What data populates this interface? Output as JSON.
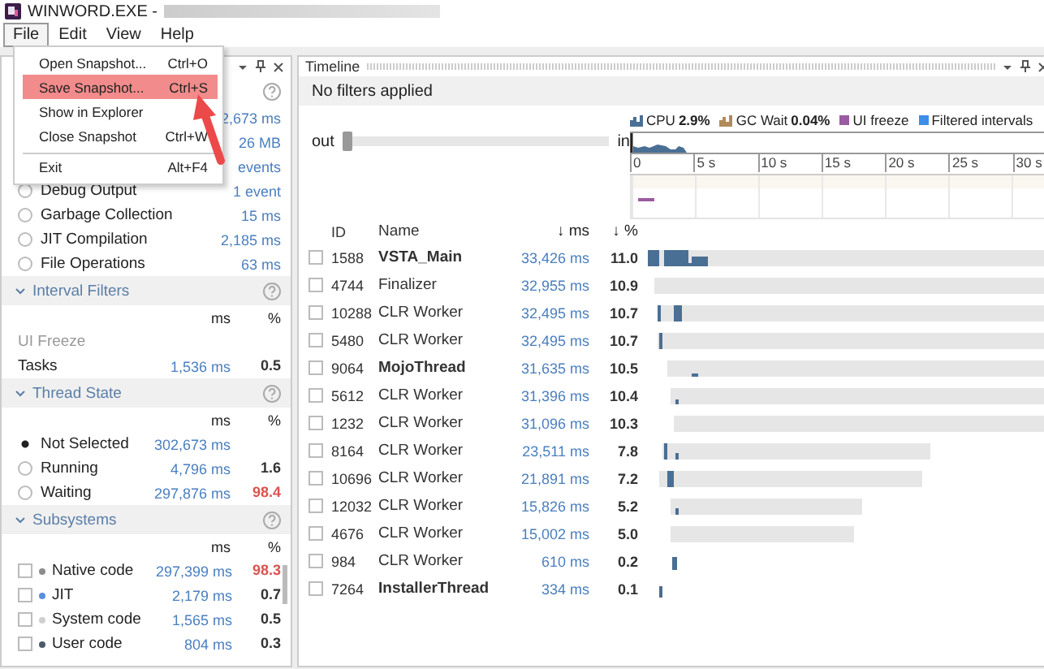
{
  "window": {
    "title": "WINWORD.EXE -"
  },
  "menu_bar": [
    {
      "label": "File",
      "selected": true
    },
    {
      "label": "Edit",
      "selected": false
    },
    {
      "label": "View",
      "selected": false
    },
    {
      "label": "Help",
      "selected": false
    }
  ],
  "file_menu": [
    {
      "label": "Open Snapshot...",
      "shortcut": "Ctrl+O",
      "selected": false,
      "separator_before": false
    },
    {
      "label": "Save Snapshot...",
      "shortcut": "Ctrl+S",
      "selected": true,
      "separator_before": false
    },
    {
      "label": "Show in Explorer",
      "selected": false,
      "separator_before": false
    },
    {
      "label": "Close Snapshot",
      "shortcut": "Ctrl+W",
      "selected": false,
      "separator_before": false
    },
    {
      "label": "Exit",
      "shortcut": "Alt+F4",
      "selected": false,
      "separator_before": true
    }
  ],
  "filters_panel": {
    "events": [
      {
        "value": "2,673 ms"
      },
      {
        "value": "26 MB"
      },
      {
        "value": "events"
      },
      {
        "label": "Debug Output",
        "value": "1 event",
        "selected": false
      },
      {
        "label": "Garbage Collection",
        "value": "15 ms",
        "selected": false
      },
      {
        "label": "JIT Compilation",
        "value": "2,185 ms",
        "selected": false
      },
      {
        "label": "File Operations",
        "value": "63 ms",
        "selected": false
      }
    ],
    "interval_filters": {
      "title": "Interval Filters",
      "columns": [
        "ms",
        "%"
      ],
      "rows": [
        {
          "label": "UI Freeze",
          "disabled": true
        },
        {
          "label": "Tasks",
          "ms": "1,536 ms",
          "percent": "0.5",
          "disabled": false
        }
      ]
    },
    "thread_state": {
      "title": "Thread State",
      "columns": [
        "ms",
        "%"
      ],
      "rows": [
        {
          "label": "Not Selected",
          "ms": "302,673 ms",
          "selected": true
        },
        {
          "label": "Running",
          "ms": "4,796 ms",
          "percent": "1.6",
          "selected": false,
          "alert": false
        },
        {
          "label": "Waiting",
          "ms": "297,876 ms",
          "percent": "98.4",
          "selected": false,
          "alert": true
        }
      ]
    },
    "subsystems": {
      "title": "Subsystems",
      "columns": [
        "ms",
        "%"
      ],
      "rows": [
        {
          "label": "Native code",
          "ms": "297,399 ms",
          "percent": "98.3",
          "checked": false,
          "color": "#8c8c8c",
          "alert": true
        },
        {
          "label": "JIT",
          "ms": "2,179 ms",
          "percent": "0.7",
          "checked": false,
          "color": "#5b8fe0",
          "alert": false
        },
        {
          "label": "System code",
          "ms": "1,565 ms",
          "percent": "0.5",
          "checked": false,
          "color": "#cfcfcf",
          "alert": false
        },
        {
          "label": "User code",
          "ms": "804 ms",
          "percent": "0.3",
          "checked": false,
          "color": "#4d5a6b",
          "alert": false
        }
      ]
    }
  },
  "timeline": {
    "title": "Timeline",
    "filter_status": "No filters applied",
    "legend": [
      {
        "label": "CPU",
        "value": "2.9%",
        "color": "#4a6f94"
      },
      {
        "label": "GC Wait",
        "value": "0.04%",
        "color": "#b08a5a"
      },
      {
        "label": "UI freeze",
        "color": "#9a5ba0"
      },
      {
        "label": "Filtered intervals",
        "color": "#3d8ee8"
      }
    ],
    "zoom": {
      "out_label": "out",
      "in_label": "in",
      "level": 0
    },
    "ruler": [
      "0",
      "5 s",
      "10 s",
      "15 s",
      "20 s",
      "25 s",
      "30 s"
    ],
    "columns": [
      "ID",
      "Name",
      "↓ ms",
      "↓ %"
    ],
    "threads": [
      {
        "id": "1588",
        "name": "VSTA_Main",
        "ms": "33,426 ms",
        "percent": "11.0",
        "emphasized": true,
        "checked": false
      },
      {
        "id": "4744",
        "name": "Finalizer",
        "ms": "32,955 ms",
        "percent": "10.9",
        "emphasized": false,
        "checked": false
      },
      {
        "id": "10288",
        "name": "CLR Worker",
        "ms": "32,495 ms",
        "percent": "10.7",
        "emphasized": false,
        "checked": false
      },
      {
        "id": "5480",
        "name": "CLR Worker",
        "ms": "32,495 ms",
        "percent": "10.7",
        "emphasized": false,
        "checked": false
      },
      {
        "id": "9064",
        "name": "MojoThread",
        "ms": "31,635 ms",
        "percent": "10.5",
        "emphasized": true,
        "checked": false
      },
      {
        "id": "5612",
        "name": "CLR Worker",
        "ms": "31,396 ms",
        "percent": "10.4",
        "emphasized": false,
        "checked": false
      },
      {
        "id": "1232",
        "name": "CLR Worker",
        "ms": "31,096 ms",
        "percent": "10.3",
        "emphasized": false,
        "checked": false
      },
      {
        "id": "8164",
        "name": "CLR Worker",
        "ms": "23,511 ms",
        "percent": "7.8",
        "emphasized": false,
        "checked": false
      },
      {
        "id": "10696",
        "name": "CLR Worker",
        "ms": "21,891 ms",
        "percent": "7.2",
        "emphasized": false,
        "checked": false
      },
      {
        "id": "12032",
        "name": "CLR Worker",
        "ms": "15,826 ms",
        "percent": "5.2",
        "emphasized": false,
        "checked": false
      },
      {
        "id": "4676",
        "name": "CLR Worker",
        "ms": "15,002 ms",
        "percent": "5.0",
        "emphasized": false,
        "checked": false
      },
      {
        "id": "984",
        "name": "CLR Worker",
        "ms": "610 ms",
        "percent": "0.2",
        "emphasized": false,
        "checked": false
      },
      {
        "id": "7264",
        "name": "InstallerThread",
        "ms": "334 ms",
        "percent": "0.1",
        "emphasized": true,
        "checked": false
      }
    ]
  }
}
